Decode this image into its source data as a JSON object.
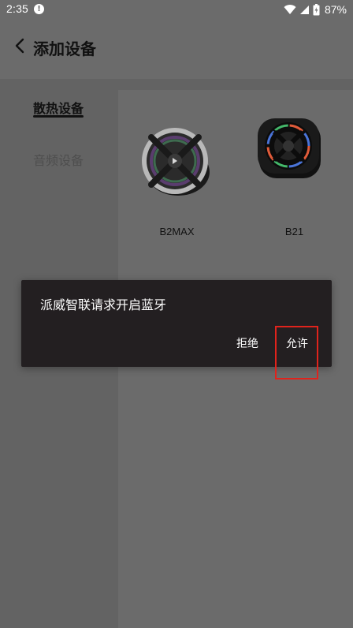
{
  "status_bar": {
    "time": "2:35",
    "alert_icon": "exclamation-circle-icon",
    "wifi_icon": "wifi-icon",
    "signal_icon": "cell-signal-icon",
    "battery_icon": "battery-icon",
    "battery_percent": "87%"
  },
  "header": {
    "back_icon": "chevron-left-icon",
    "title": "添加设备"
  },
  "categories": [
    {
      "label": "散热设备",
      "active": true
    },
    {
      "label": "音频设备",
      "active": false
    }
  ],
  "devices": [
    {
      "name": "B2MAX",
      "icon": "cooling-fan-icon",
      "accent": "#b9b9b9"
    },
    {
      "name": "B21",
      "icon": "cooling-fan-icon",
      "accent": "#1a1a1a"
    }
  ],
  "dialog": {
    "message": "派威智联请求开启蓝牙",
    "deny_label": "拒绝",
    "allow_label": "允许"
  },
  "colors": {
    "overlay_bg": "#6b6b6b",
    "dialog_bg": "#231f21",
    "highlight": "#e0231c"
  }
}
